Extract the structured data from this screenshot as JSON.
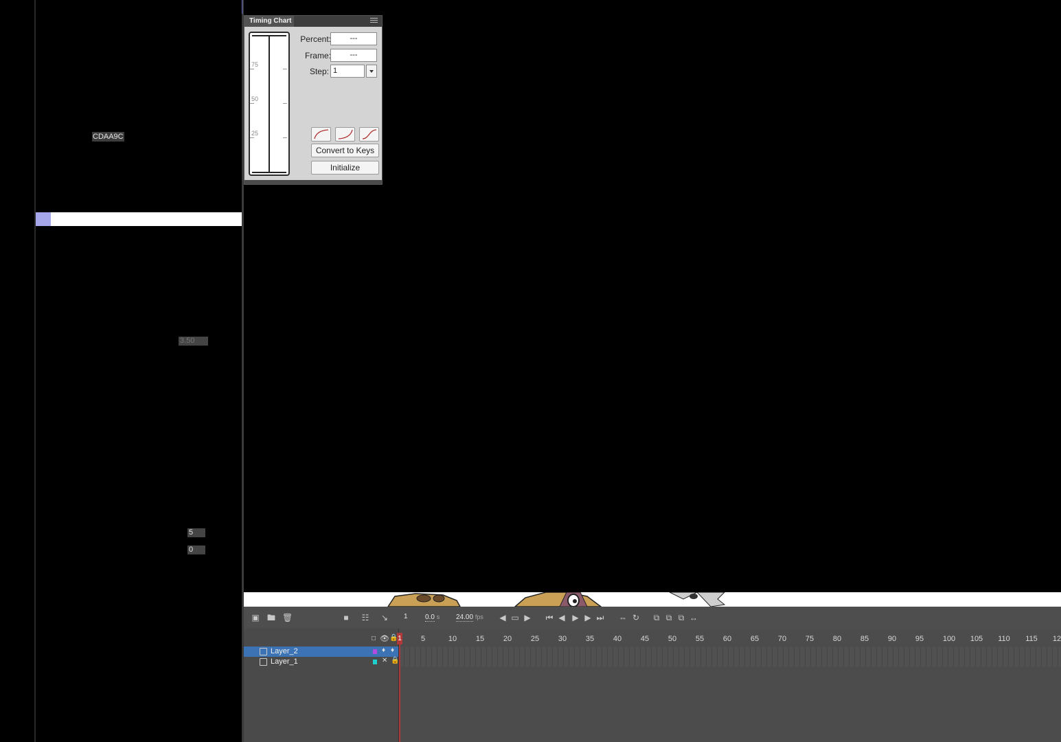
{
  "left_panel": {
    "hex_value": "CDAA9C",
    "dim_value": "3.50",
    "field_a": "5",
    "field_b": "0"
  },
  "timing_chart": {
    "title": "Timing Chart",
    "graph_labels": [
      "75",
      "50",
      "25"
    ],
    "percent_label": "Percent:",
    "percent_value": "---",
    "frame_label": "Frame:",
    "frame_value": "---",
    "step_label": "Step:",
    "step_value": "1",
    "convert_button": "Convert to Keys",
    "initialize_button": "Initialize"
  },
  "timeline": {
    "current_frame": "1",
    "time_value": "0.0",
    "time_unit": "s",
    "fps_value": "24.00",
    "fps_unit": "fps",
    "playhead_label": "1",
    "ruler": [
      "5",
      "10",
      "15",
      "20",
      "25",
      "30",
      "35",
      "40",
      "45",
      "50",
      "55",
      "60",
      "65",
      "70",
      "75",
      "80",
      "85",
      "90",
      "95",
      "100",
      "105",
      "110",
      "115",
      "12"
    ],
    "layers": [
      {
        "name": "Layer_2",
        "color": "#b44be0",
        "selected": true
      },
      {
        "name": "Layer_1",
        "color": "#1fd0d0",
        "selected": false
      }
    ]
  }
}
